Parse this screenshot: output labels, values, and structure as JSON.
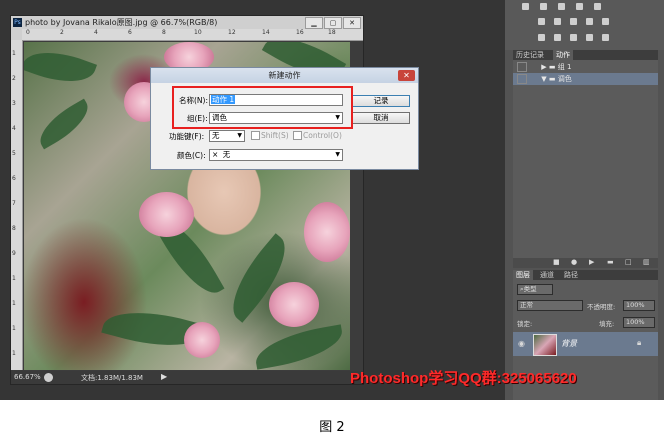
{
  "document": {
    "title": "photo by Jovana Rikalo原图.jpg @ 66.7%(RGB/8)",
    "app_badge": "Ps",
    "zoom": "66.67%",
    "doc_size": "文档:1.83M/1.83M",
    "ruler_top": [
      "0",
      "2",
      "4",
      "6",
      "8",
      "10",
      "12",
      "14",
      "16",
      "18"
    ],
    "ruler_left": [
      "1",
      "2",
      "3",
      "4",
      "5",
      "6",
      "7",
      "8",
      "9",
      "1",
      "1",
      "1",
      "1"
    ]
  },
  "dialog": {
    "title": "新建动作",
    "name_label": "名称(N):",
    "name_value": "动作 1",
    "group_label": "组(E):",
    "group_value": "调色",
    "fkey_label": "功能键(F):",
    "fkey_value": "无",
    "shift_label": "Shift(S)",
    "control_label": "Control(O)",
    "color_label": "颜色(C):",
    "color_x": "×",
    "color_value": "无",
    "record_button": "记录",
    "cancel_button": "取消",
    "close_glyph": "✕"
  },
  "panels": {
    "history_tab": "历史记录",
    "actions_tab": "动作",
    "actions": [
      {
        "label": "组 1"
      },
      {
        "label": "调色"
      }
    ],
    "layers_tab": "图层",
    "channels_tab": "通道",
    "paths_tab": "路径",
    "kind_label": "类型",
    "blend_mode": "正常",
    "opacity_label": "不透明度:",
    "opacity_value": "100%",
    "lock_label": "锁定:",
    "fill_label": "填充:",
    "fill_value": "100%",
    "layer_name": "背景"
  },
  "watermark": "Photoshop学习QQ群:325065620",
  "caption": "图 2",
  "colors": {
    "highlight": "#e8201f",
    "watermark": "#ff2a2a",
    "selected_row": "#6b7a8f"
  }
}
